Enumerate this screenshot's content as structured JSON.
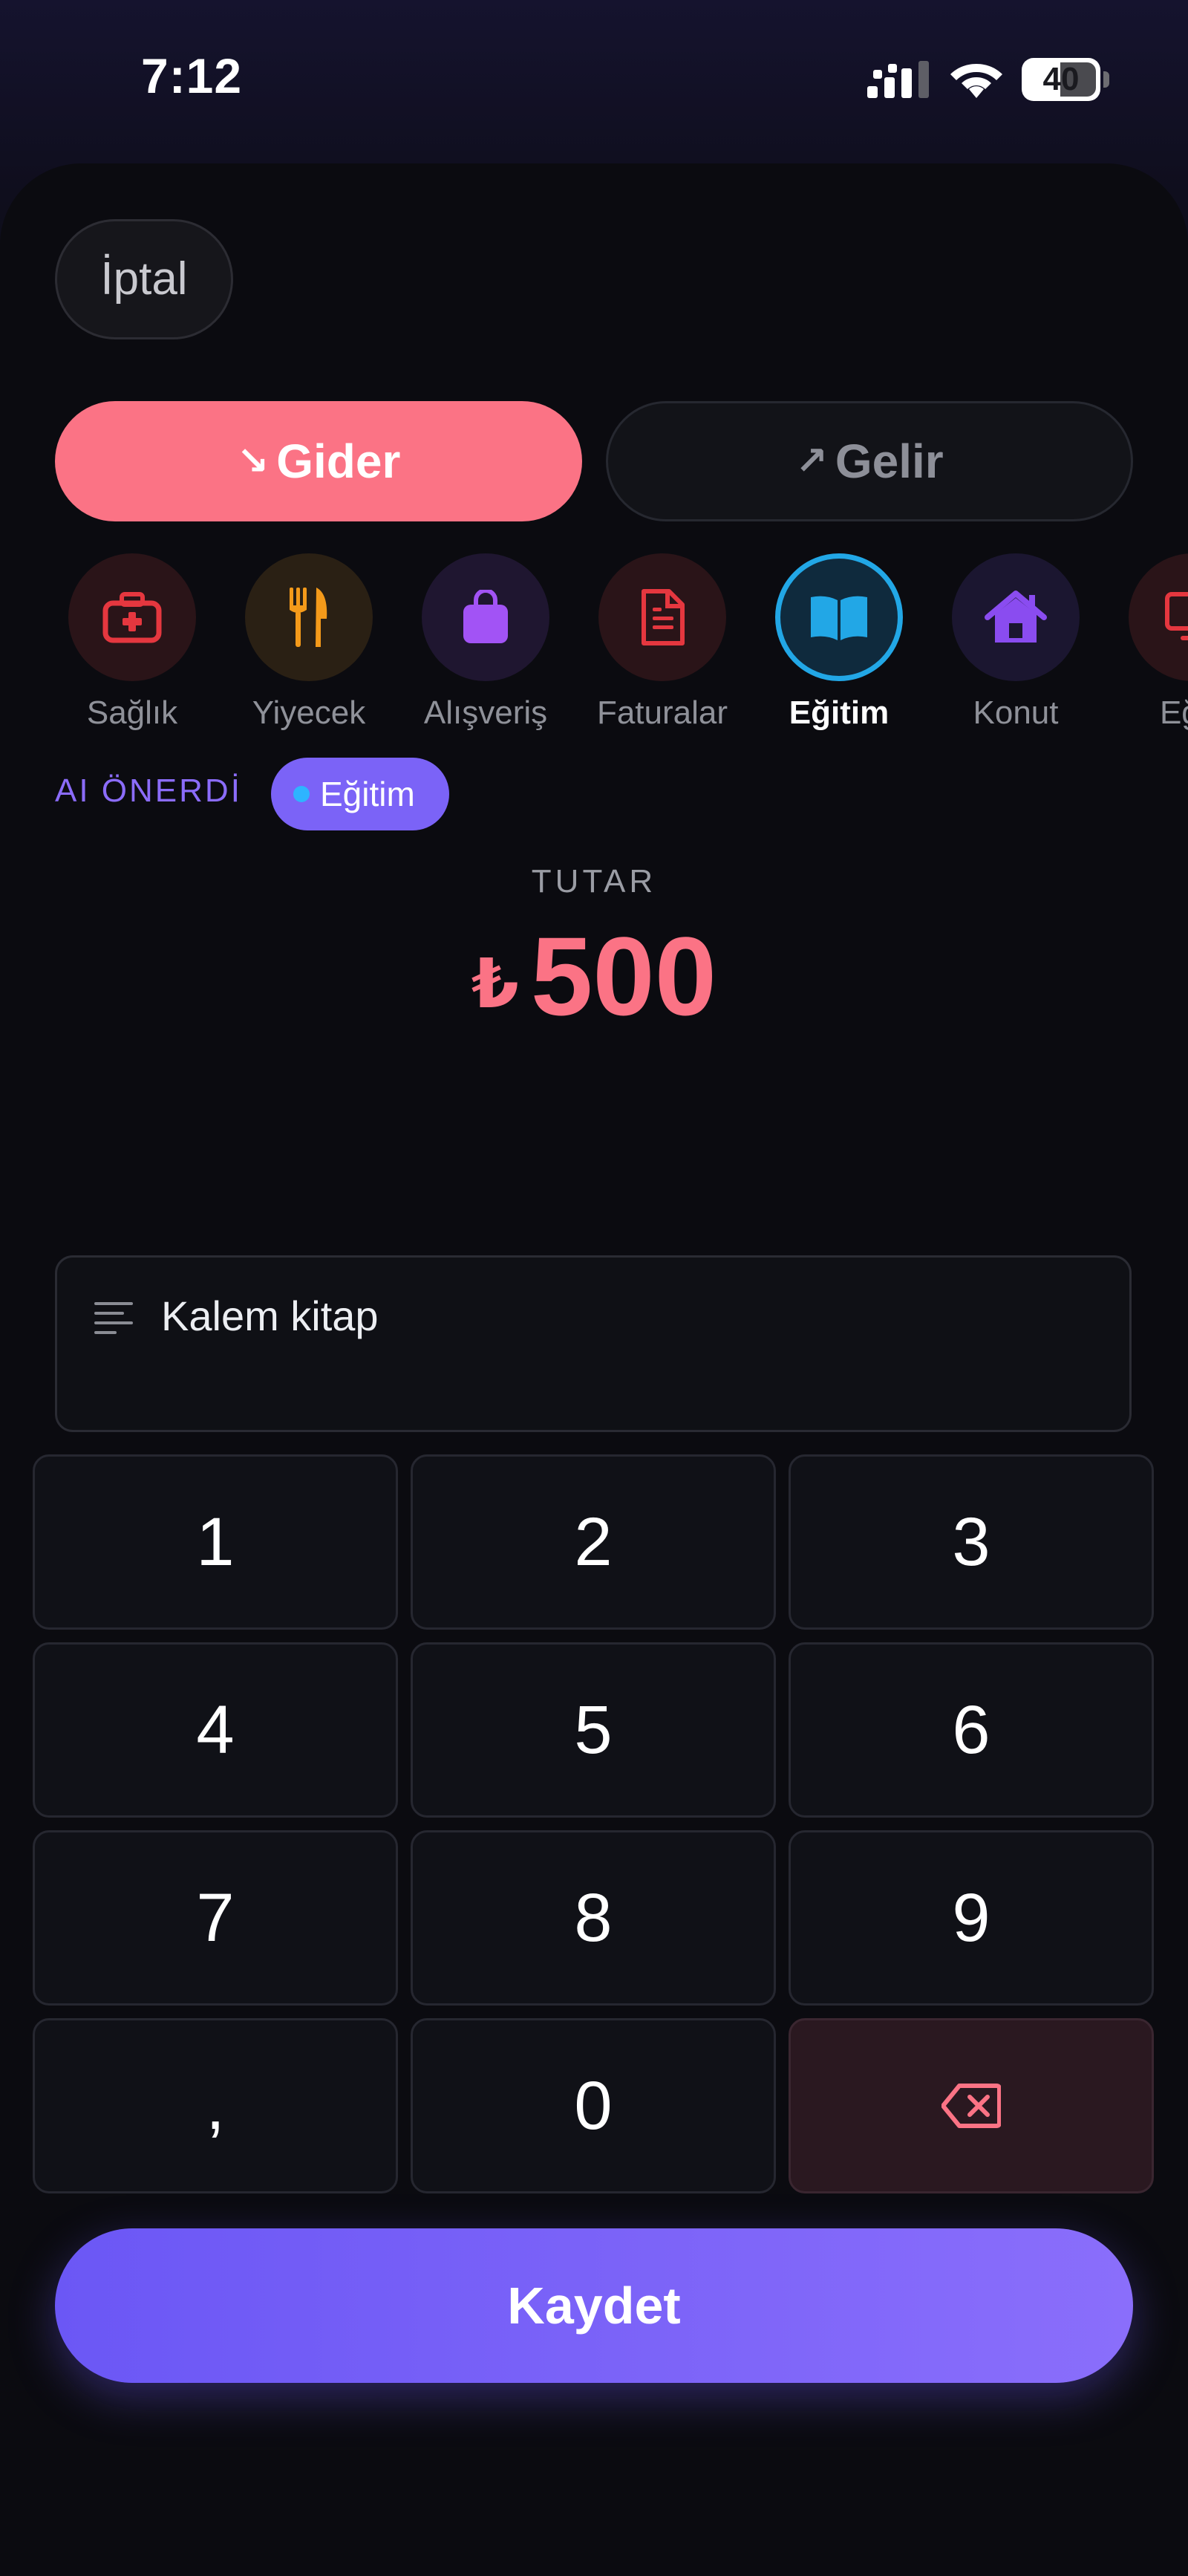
{
  "status_bar": {
    "time": "7:12",
    "battery": "40",
    "signal_icon": "cellular-signal-icon",
    "wifi_icon": "wifi-icon"
  },
  "header": {
    "cancel_label": "İptal"
  },
  "type_toggle": {
    "expense": {
      "label": "Gider",
      "arrow": "↘",
      "selected": true,
      "color": "#fb7385"
    },
    "income": {
      "label": "Gelir",
      "arrow": "↗",
      "selected": false
    }
  },
  "categories": [
    {
      "label": "Sağlık",
      "icon": "first-aid-kit-icon",
      "color": "#e5373f",
      "bg": "#2a1418",
      "selected": false
    },
    {
      "label": "Yiyecek",
      "icon": "fork-knife-icon",
      "color": "#f49a1a",
      "bg": "#2a2014",
      "selected": false
    },
    {
      "label": "Alışveriş",
      "icon": "shopping-bag-icon",
      "color": "#a253f5",
      "bg": "#1f1630",
      "selected": false
    },
    {
      "label": "Faturalar",
      "icon": "document-icon",
      "color": "#e5373f",
      "bg": "#2a1418",
      "selected": false
    },
    {
      "label": "Eğitim",
      "icon": "open-book-icon",
      "color": "#22a7e6",
      "bg": "#0f2a3d",
      "selected": true
    },
    {
      "label": "Konut",
      "icon": "home-icon",
      "color": "#8a4cf0",
      "bg": "#1b1630",
      "selected": false
    },
    {
      "label": "Eğle",
      "icon": "monitor-icon",
      "color": "#e5373f",
      "bg": "#2a1418",
      "selected": false
    }
  ],
  "ai_suggestion": {
    "label": "AI ÖNERDİ",
    "chip": "Eğitim"
  },
  "amount": {
    "label": "TUTAR",
    "currency": "₺",
    "value": "500"
  },
  "note": {
    "icon": "text-lines-icon",
    "value": "Kalem kitap"
  },
  "keypad": {
    "keys": [
      "1",
      "2",
      "3",
      "4",
      "5",
      "6",
      "7",
      "8",
      "9",
      ",",
      "0"
    ],
    "backspace_icon": "backspace-icon"
  },
  "save_label": "Kaydet",
  "colors": {
    "accent": "#7b63f7",
    "expense": "#fb7385",
    "selected_ring": "#22a7e6"
  }
}
